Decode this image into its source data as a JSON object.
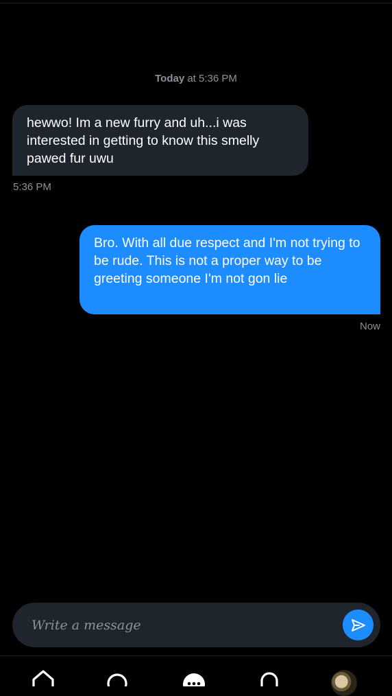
{
  "conversation": {
    "date_header": {
      "day": "Today",
      "time": "at 5:36 PM"
    },
    "messages": [
      {
        "direction": "incoming",
        "text": "hewwo! Im a new furry and uh...i was interested in getting to know this smelly pawed fur uwu",
        "timestamp": "5:36 PM"
      },
      {
        "direction": "outgoing",
        "text": "Bro. With all due respect and I'm not trying to be rude. This is not a proper way to be greeting someone I'm not gon lie",
        "timestamp": "Now"
      }
    ]
  },
  "composer": {
    "placeholder": "Write a message",
    "value": "",
    "send_icon": "send-icon"
  },
  "bottom_nav": {
    "items": [
      {
        "icon": "home-icon"
      },
      {
        "icon": "search-icon"
      },
      {
        "icon": "messages-icon"
      },
      {
        "icon": "notifications-icon"
      },
      {
        "icon": "profile-avatar"
      }
    ]
  },
  "colors": {
    "background": "#000000",
    "incoming_bubble": "#1e252c",
    "outgoing_bubble": "#1d8cff",
    "muted_text": "#8b939c",
    "accent": "#1d8cff"
  }
}
